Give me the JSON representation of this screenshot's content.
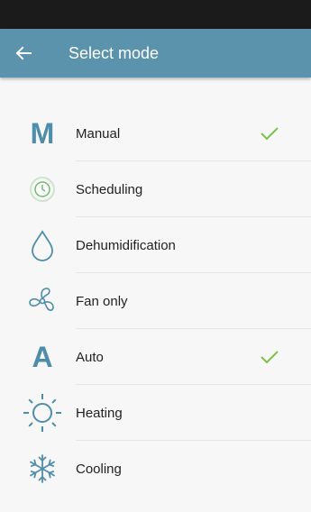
{
  "app_bar": {
    "title": "Select mode",
    "back_icon": "arrow-left-icon"
  },
  "colors": {
    "app_bar": "#5a93ab",
    "icon": "#4f8eaa",
    "check": "#7cc24a",
    "background": "#f7f7f7"
  },
  "modes": [
    {
      "label": "Manual",
      "icon": "letter-m-icon",
      "checked": true
    },
    {
      "label": "Scheduling",
      "icon": "clock-icon",
      "checked": false
    },
    {
      "label": "Dehumidification",
      "icon": "droplet-icon",
      "checked": false
    },
    {
      "label": "Fan only",
      "icon": "fan-icon",
      "checked": false
    },
    {
      "label": "Auto",
      "icon": "letter-a-icon",
      "checked": true
    },
    {
      "label": "Heating",
      "icon": "sun-icon",
      "checked": false
    },
    {
      "label": "Cooling",
      "icon": "snowflake-icon",
      "checked": false
    }
  ]
}
